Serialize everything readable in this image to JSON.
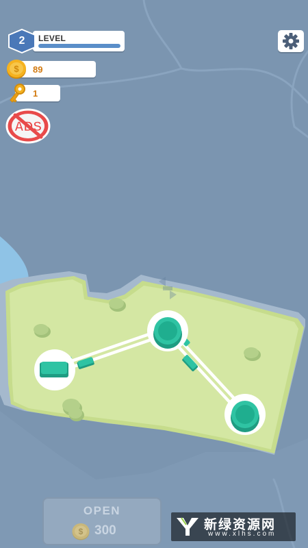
{
  "hud": {
    "level": {
      "number": "2",
      "label": "LEVEL",
      "progress": 1.0
    },
    "coins": {
      "value": "89",
      "icon": "dollar-coin-icon"
    },
    "keys": {
      "value": "1",
      "icon": "key-icon"
    },
    "no_ads": {
      "text": "ADS",
      "icon": "no-ads-icon"
    },
    "settings": {
      "icon": "gear-icon"
    }
  },
  "open_button": {
    "label": "OPEN",
    "price": "300",
    "coin_symbol": "$"
  },
  "watermark": {
    "title": "新绿资源网",
    "url": "www.xlhs.com"
  },
  "colors": {
    "water": "#7b95b0",
    "island": "#d4e7a3",
    "island_edge": "#c6dc8c",
    "trees": "#b4d08a",
    "node_green": "#2fc3a3",
    "level_bar": "#5a8ec9",
    "coin": "#f5b21f"
  }
}
